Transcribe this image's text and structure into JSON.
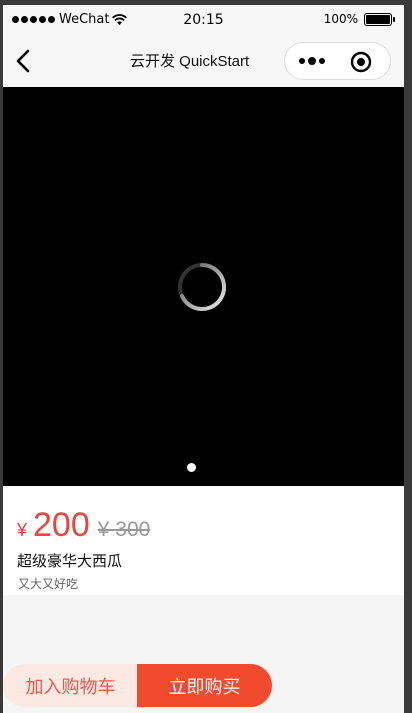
{
  "status_bar": {
    "carrier": "WeChat",
    "time": "20:15",
    "battery": "100%"
  },
  "nav": {
    "title": "云开发 QuickStart"
  },
  "product": {
    "currency": "¥",
    "price": "200",
    "original_price": "¥ 300",
    "title": "超级豪华大西瓜",
    "subtitle": "又大又好吃"
  },
  "actions": {
    "add_to_cart": "加入购物车",
    "buy_now": "立即购买"
  },
  "colors": {
    "accent": "#e8453c",
    "buy_button": "#f24a2e",
    "cart_button_bg": "#fde9e4"
  },
  "icons": {
    "back": "chevron-left-icon",
    "more": "more-dots-icon",
    "close": "target-close-icon",
    "loading": "loading-spinner-icon"
  }
}
